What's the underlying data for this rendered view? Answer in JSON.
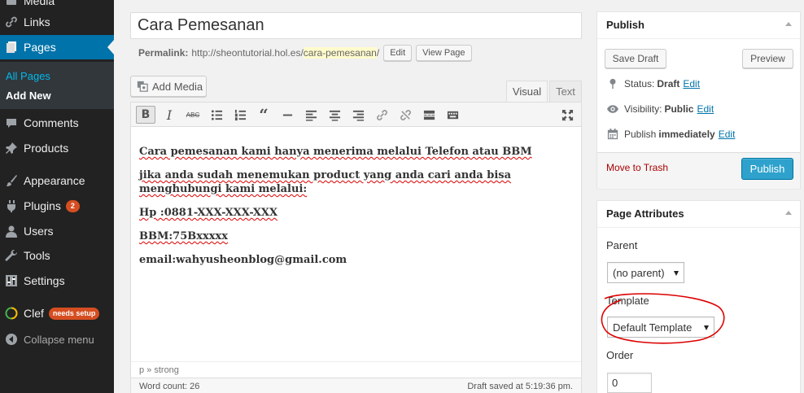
{
  "sidebar": {
    "items": [
      {
        "label": "Media",
        "icon": "media-icon"
      },
      {
        "label": "Links",
        "icon": "link-icon"
      },
      {
        "label": "Pages",
        "icon": "pages-icon",
        "active": true
      },
      {
        "label": "Comments",
        "icon": "comments-icon"
      },
      {
        "label": "Products",
        "icon": "pin-icon"
      },
      {
        "label": "Appearance",
        "icon": "brush-icon"
      },
      {
        "label": "Plugins",
        "icon": "plugin-icon",
        "badge": "2"
      },
      {
        "label": "Users",
        "icon": "user-icon"
      },
      {
        "label": "Tools",
        "icon": "wrench-icon"
      },
      {
        "label": "Settings",
        "icon": "settings-icon"
      },
      {
        "label": "Clef",
        "icon": "clef-icon",
        "badge": "needs setup"
      }
    ],
    "submenu": {
      "all_pages": "All Pages",
      "add_new": "Add New"
    },
    "collapse": "Collapse menu"
  },
  "editor": {
    "title": "Cara Pemesanan",
    "permalink_label": "Permalink:",
    "permalink_base": "http://sheontutorial.hol.es/",
    "permalink_slug": "cara-pemesanan",
    "permalink_trailing": "/",
    "edit_button": "Edit",
    "view_page_button": "View Page",
    "add_media": "Add Media",
    "tab_visual": "Visual",
    "tab_text": "Text",
    "toolbar": [
      "bold-button",
      "italic-button",
      "strikethrough-button",
      "bullet-list-button",
      "numbered-list-button",
      "blockquote-button",
      "horizontal-line-button",
      "align-left-button",
      "align-center-button",
      "align-right-button",
      "insert-link-button",
      "remove-link-button",
      "read-more-button",
      "toolbar-toggle-button",
      "fullscreen-button"
    ],
    "content": [
      "Cara pemesanan kami hanya menerima melalui Telefon atau BBM",
      "jika anda sudah menemukan product yang anda cari anda bisa menghubungi kami melalui:",
      "Hp :0881-XXX-XXX-XXX",
      "BBM:75Bxxxxx",
      "email:wahyusheonblog@gmail.com"
    ],
    "path": "p » strong",
    "word_count": "Word count: 26",
    "draft_saved": "Draft saved at 5:19:36 pm."
  },
  "publish": {
    "title": "Publish",
    "save_draft": "Save Draft",
    "preview": "Preview",
    "status_label": "Status:",
    "status_value": "Draft",
    "visibility_label": "Visibility:",
    "visibility_value": "Public",
    "schedule_label": "Publish",
    "schedule_value": "immediately",
    "edit_link": "Edit",
    "trash": "Move to Trash",
    "publish_button": "Publish"
  },
  "attributes": {
    "title": "Page Attributes",
    "parent_label": "Parent",
    "parent_value": "(no parent)",
    "template_label": "Template",
    "template_value": "Default Template",
    "order_label": "Order",
    "order_value": "0"
  },
  "colors": {
    "sidebar_bg": "#222222",
    "active_menu": "#0073aa",
    "primary_button": "#2ea2cc",
    "annotation": "#dd0000",
    "trash": "#aa0000"
  }
}
